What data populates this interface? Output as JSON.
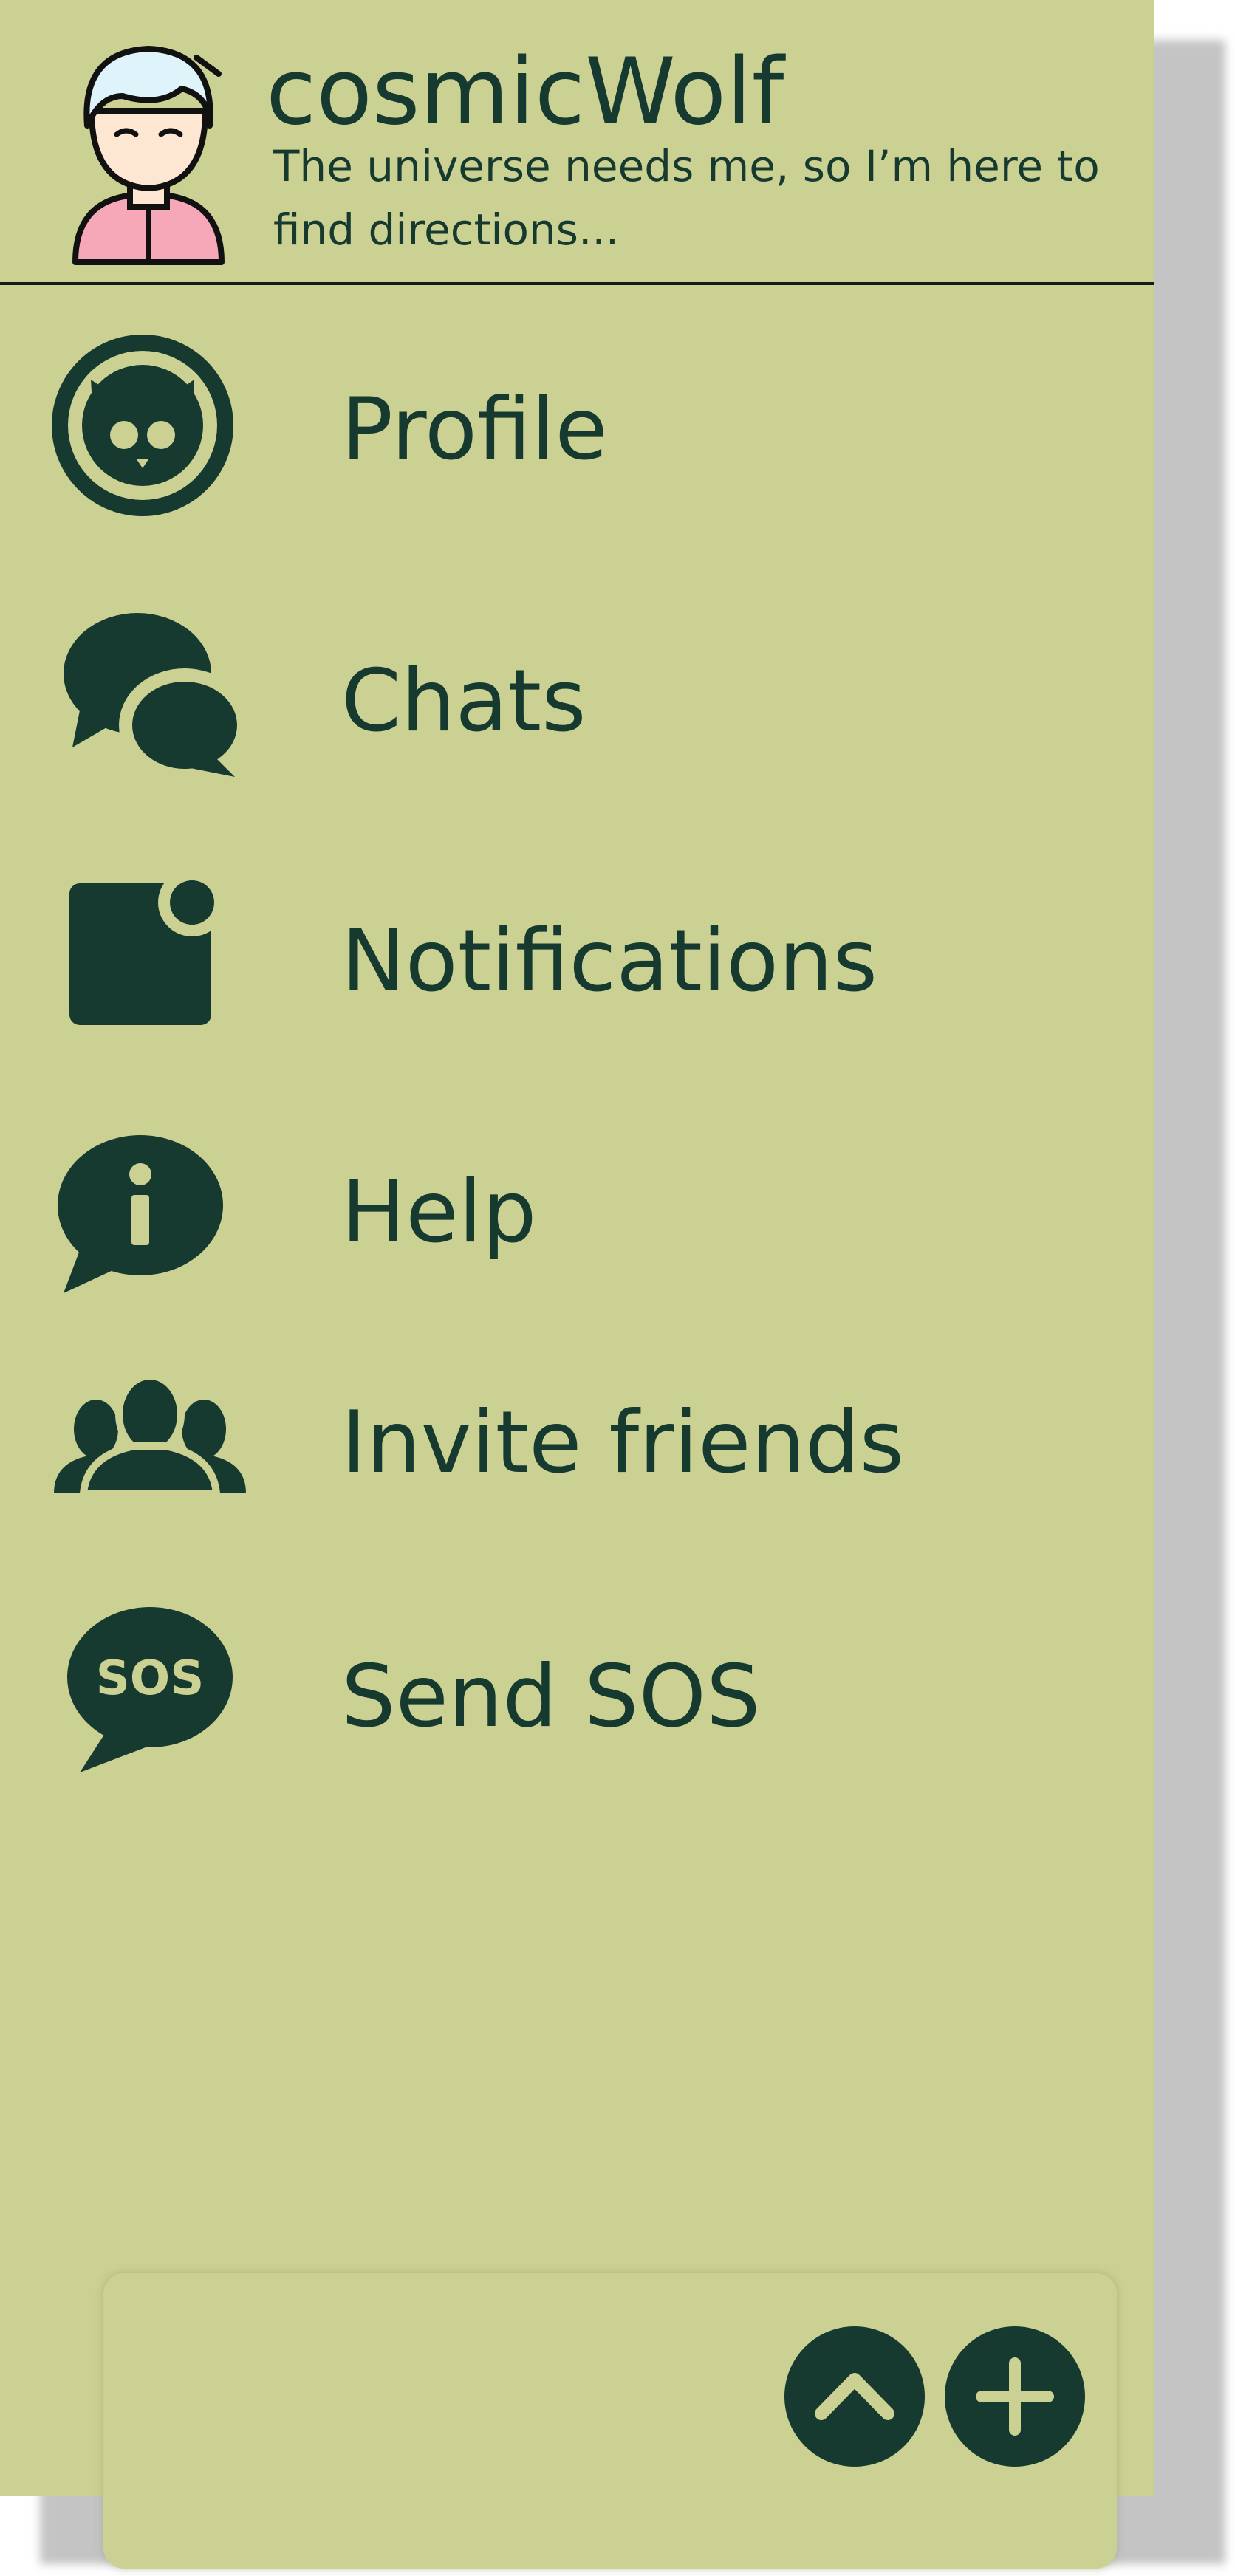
{
  "user": {
    "name": "cosmicWolf",
    "status": "The universe needs me, so I’m here to find directions..."
  },
  "menu": {
    "items": [
      {
        "label": "Profile",
        "icon": "cat-profile-icon"
      },
      {
        "label": "Chats",
        "icon": "chat-bubbles-icon"
      },
      {
        "label": "Notifications",
        "icon": "notification-icon"
      },
      {
        "label": "Help",
        "icon": "info-bubble-icon"
      },
      {
        "label": "Invite friends",
        "icon": "group-icon"
      },
      {
        "label": "Send SOS",
        "icon": "sos-bubble-icon"
      }
    ]
  },
  "icons": {
    "sos_text": "SOS"
  },
  "bottom": {
    "scroll_up_icon": "chevron-up-icon",
    "add_icon": "plus-icon"
  },
  "colors": {
    "background": "#cbd193",
    "accent": "#163a2f",
    "shadow": "#c4c4c4"
  }
}
